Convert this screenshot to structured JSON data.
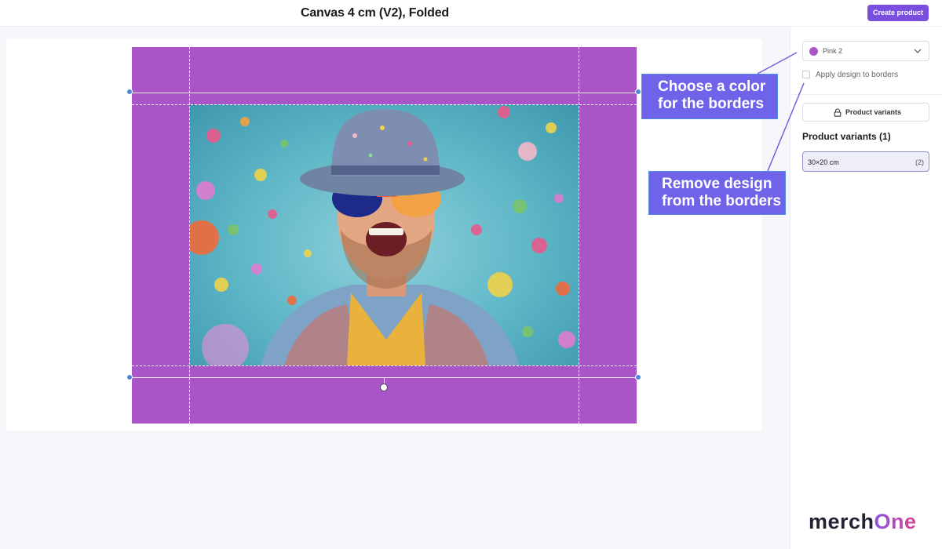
{
  "header": {
    "title": "Canvas 4 cm (V2), Folded",
    "create_button_label": "Create product"
  },
  "editor": {
    "border_color": "#a955c8",
    "selection_handle_color": "#4f86d6",
    "photo_description_icon": "party-photo"
  },
  "sidebar": {
    "color_select": {
      "value": "Pink 2",
      "swatch_color": "#a955c8",
      "icon": "chevron-down-icon"
    },
    "apply_design_checkbox": {
      "label": "Apply design to borders",
      "checked": false
    },
    "product_variants_button": {
      "label": "Product variants",
      "icon": "lock-icon"
    },
    "variants_heading": "Product variants (1)",
    "variants": [
      {
        "size": "30×20 cm",
        "count": "(2)"
      }
    ]
  },
  "callouts": {
    "color": {
      "line1": "Choose a color",
      "line2": "for the borders"
    },
    "remove": {
      "line1": "Remove design",
      "line2": "from the borders"
    },
    "fill_color": "#6f63ea"
  },
  "brand": {
    "logo_part1": "merch",
    "logo_part2": "One"
  }
}
